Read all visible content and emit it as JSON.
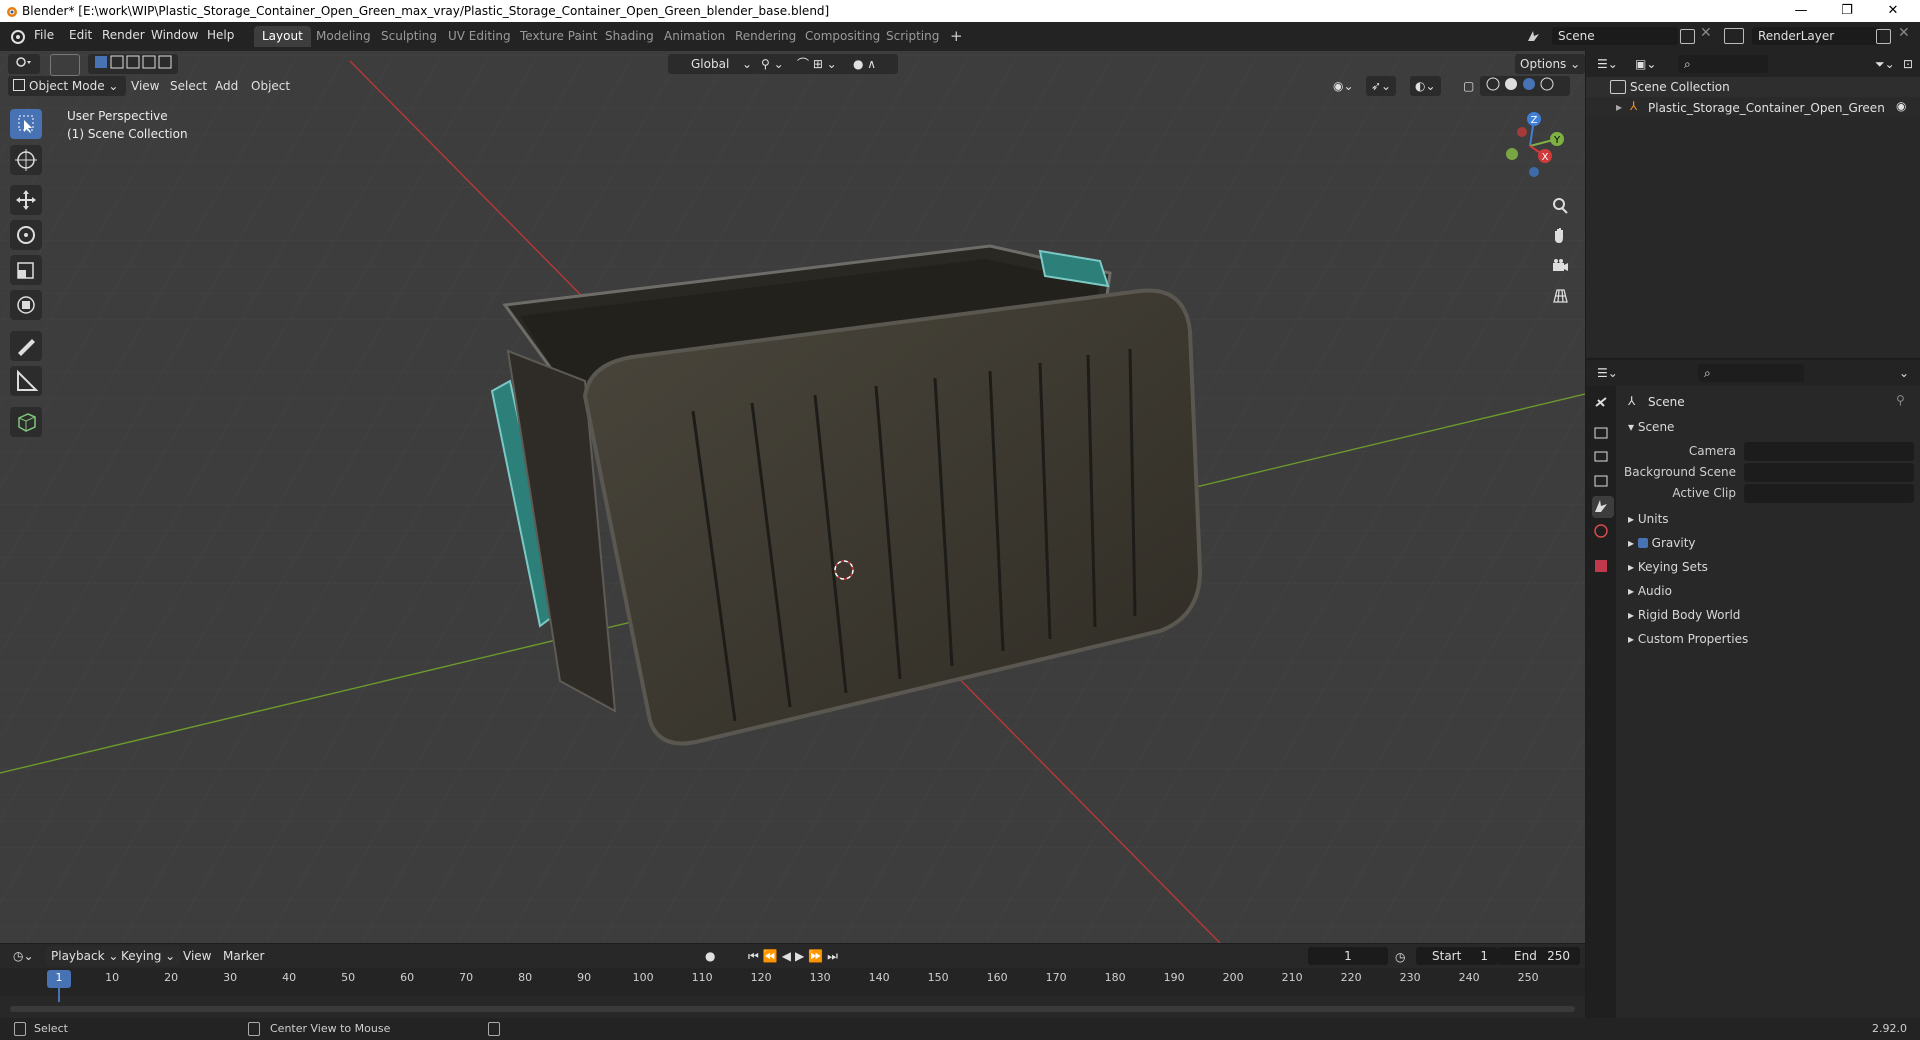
{
  "window": {
    "title": "Blender* [E:\\work\\WIP\\Plastic_Storage_Container_Open_Green_max_vray/Plastic_Storage_Container_Open_Green_blender_base.blend]",
    "minimize": "—",
    "maximize": "❐",
    "close": "✕"
  },
  "menu": [
    "File",
    "Edit",
    "Render",
    "Window",
    "Help"
  ],
  "workspaces": [
    "Layout",
    "Modeling",
    "Sculpting",
    "UV Editing",
    "Texture Paint",
    "Shading",
    "Animation",
    "Rendering",
    "Compositing",
    "Scripting"
  ],
  "add_workspace": "+",
  "scene_field": "Scene",
  "renderlayer_field": "RenderLayer",
  "viewport": {
    "mode": "Object Mode",
    "menus": [
      "View",
      "Select",
      "Add",
      "Object"
    ],
    "orientation": "Global",
    "options": "Options",
    "perspective": "User Perspective",
    "collection": "(1) Scene Collection",
    "gizmo": {
      "x": "X",
      "y": "Y",
      "z": "Z"
    }
  },
  "outliner": {
    "root": "Scene Collection",
    "item": "Plastic_Storage_Container_Open_Green"
  },
  "properties": {
    "header": "Scene",
    "section": "Scene",
    "camera_label": "Camera",
    "background_scene_label": "Background Scene",
    "active_clip_label": "Active Clip",
    "subsections": [
      "Units",
      "Gravity",
      "Keying Sets",
      "Audio",
      "Rigid Body World",
      "Custom Properties"
    ]
  },
  "timeline": {
    "menus": [
      "Playback",
      "Keying",
      "View",
      "Marker"
    ],
    "current_frame": "1",
    "start_label": "Start",
    "start_value": "1",
    "end_label": "End",
    "end_value": "250",
    "ticks": [
      "1",
      "10",
      "20",
      "30",
      "40",
      "50",
      "60",
      "70",
      "80",
      "90",
      "100",
      "110",
      "120",
      "130",
      "140",
      "150",
      "160",
      "170",
      "180",
      "190",
      "200",
      "210",
      "220",
      "230",
      "240",
      "250"
    ]
  },
  "status": {
    "select": "Select",
    "center_view": "Center View to Mouse",
    "version": "2.92.0"
  },
  "colors": {
    "accent": "#4772b3",
    "viewport_bg": "#3e3e3e",
    "x_axis": "#d03a3a",
    "y_axis": "#7fb043",
    "z_axis": "#3f7fd6"
  }
}
